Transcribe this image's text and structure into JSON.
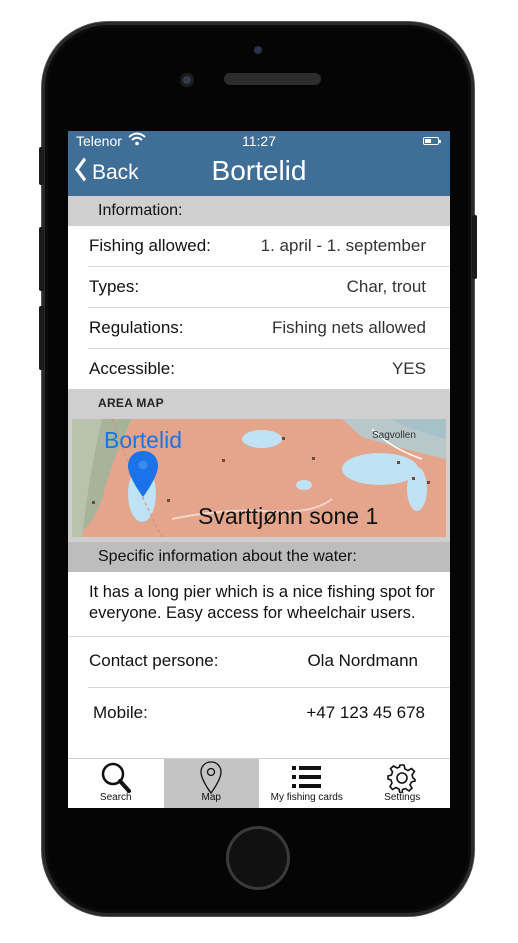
{
  "status_bar": {
    "carrier": "Telenor",
    "time": "11:27",
    "wifi_icon": "wifi-icon",
    "battery_icon": "battery-icon"
  },
  "nav": {
    "back_label": "Back",
    "title": "Bortelid"
  },
  "information": {
    "header": "Information:",
    "rows": [
      {
        "label": "Fishing allowed:",
        "value": "1. april - 1. september"
      },
      {
        "label": "Types:",
        "value": "Char, trout"
      },
      {
        "label": "Regulations:",
        "value": "Fishing nets allowed"
      },
      {
        "label": "Accessible:",
        "value": "YES"
      }
    ]
  },
  "area_map": {
    "header": "AREA MAP",
    "pin_label": "Bortelid",
    "zone_label": "Svarttjønn sone 1",
    "town_label": "Sagvollen"
  },
  "specific": {
    "header": "Specific information about the water:",
    "description": "It has a long pier which is a nice fishing spot for everyone. Easy access for wheelchair users."
  },
  "contact": {
    "person_label": "Contact persone:",
    "person_value": "Ola Nordmann",
    "mobile_label": "Mobile:",
    "mobile_value": "+47 123 45 678"
  },
  "tabs": [
    {
      "label": "Search",
      "icon": "search-icon",
      "active": false
    },
    {
      "label": "Map",
      "icon": "map-pin-icon",
      "active": true
    },
    {
      "label": "My fishing cards",
      "icon": "list-icon",
      "active": false
    },
    {
      "label": "Settings",
      "icon": "gear-icon",
      "active": false
    }
  ],
  "colors": {
    "header_blue": "#3f6e96",
    "section_gray": "#cfcfcf",
    "active_tab": "#c4c4c4",
    "pin_blue": "#1a73e8"
  }
}
